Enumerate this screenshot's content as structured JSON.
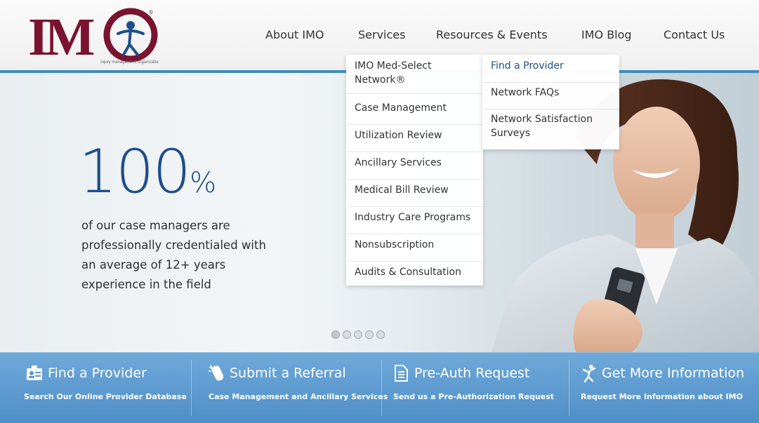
{
  "logo": {
    "letters": "IMO",
    "tagline": "injury management organization",
    "registered_mark": "®"
  },
  "nav": {
    "items": [
      {
        "label": "About IMO"
      },
      {
        "label": "Services"
      },
      {
        "label": "Resources & Events"
      },
      {
        "label": "IMO Blog"
      },
      {
        "label": "Contact Us"
      }
    ]
  },
  "services_menu": {
    "items": [
      {
        "label": "IMO Med-Select Network®"
      },
      {
        "label": "Case Management"
      },
      {
        "label": "Utilization Review"
      },
      {
        "label": "Ancillary Services"
      },
      {
        "label": "Medical Bill Review"
      },
      {
        "label": "Industry Care Programs"
      },
      {
        "label": "Nonsubscription"
      },
      {
        "label": "Audits & Consultation"
      }
    ]
  },
  "network_submenu": {
    "items": [
      {
        "label": "Find a Provider"
      },
      {
        "label": "Network FAQs"
      },
      {
        "label": "Network Satisfaction Surveys"
      }
    ]
  },
  "hero": {
    "stat_number": "100",
    "stat_suffix": "%",
    "stat_text": "of our case managers are professionally credentialed with an average of 12+ years experience in the field",
    "slide_count": 5,
    "active_slide": 1
  },
  "cta_bar": {
    "items": [
      {
        "title": "Find a Provider",
        "subtitle": "Search Our Online Provider Database",
        "icon": "provider-card-icon"
      },
      {
        "title": "Submit a Referral",
        "subtitle": "Case Management and Ancillary Services",
        "icon": "mouse-click-icon"
      },
      {
        "title": "Pre-Auth Request",
        "subtitle": "Send us a Pre-Authorization Request",
        "icon": "document-icon"
      },
      {
        "title": "Get More Information",
        "subtitle": "Request More Information about IMO",
        "icon": "person-info-icon"
      }
    ]
  },
  "colors": {
    "brand_maroon": "#7a1330",
    "brand_blue": "#1e4e8a",
    "accent_blue": "#3c8bbf",
    "cta_bar": "#5b98cf"
  }
}
